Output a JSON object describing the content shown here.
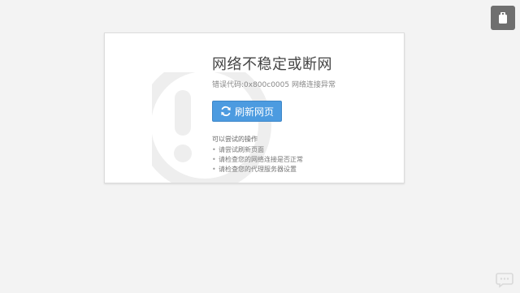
{
  "error_page": {
    "title": "网络不稳定或断网",
    "error_code": "错误代码:0x800c0005 网络连接异常",
    "refresh_button_label": "刷新网页",
    "tips_title": "可以尝试的操作",
    "tips": [
      "请尝试刷新页面",
      "请检查您的网络连接是否正常",
      "请检查您的代理服务器设置"
    ]
  },
  "icons": {
    "corner_button": "bookmark-icon",
    "refresh": "refresh-icon",
    "background": "warning-exclamation-icon"
  },
  "colors": {
    "page_background": "#f3f3f3",
    "button_blue": "#4c9be0",
    "corner_button": "#6f6f6f"
  }
}
